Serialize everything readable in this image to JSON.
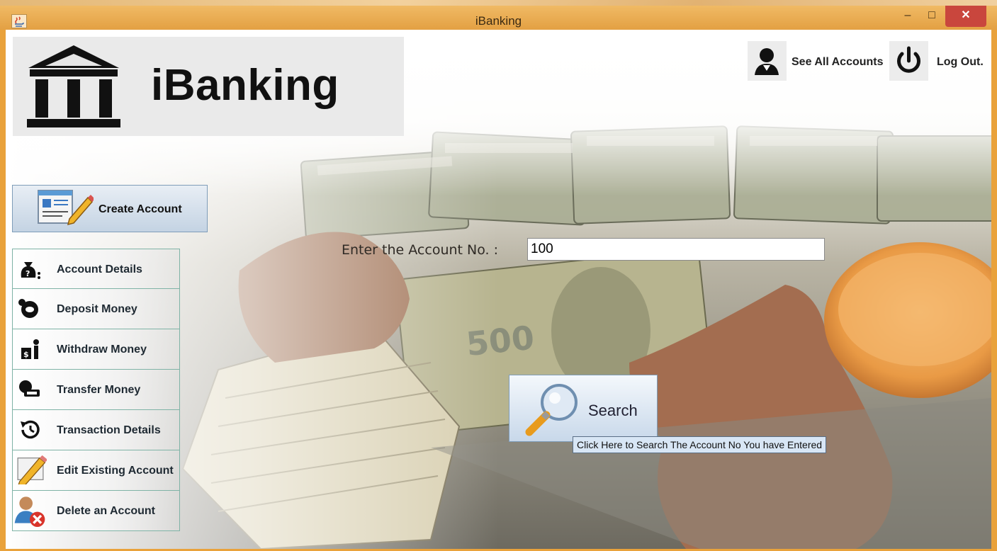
{
  "window": {
    "title": "iBanking",
    "minimize_glyph": "‒",
    "maximize_glyph": "□",
    "close_glyph": "✕"
  },
  "header": {
    "brand": "iBanking",
    "see_all_accounts": "See All Accounts",
    "log_out": "Log Out."
  },
  "create_account": {
    "label": "Create Account",
    "icon": "form-pencil-icon"
  },
  "sidebar": {
    "items": [
      {
        "label": "Account Details",
        "icon": "money-bag-question-icon"
      },
      {
        "label": "Deposit Money",
        "icon": "coin-deposit-icon"
      },
      {
        "label": "Withdraw Money",
        "icon": "withdraw-person-icon"
      },
      {
        "label": "Transfer Money",
        "icon": "money-transfer-icon"
      },
      {
        "label": "Transaction Details",
        "icon": "history-icon"
      },
      {
        "label": "Edit Existing Account",
        "icon": "edit-pencil-icon"
      },
      {
        "label": "Delete an Account",
        "icon": "delete-user-icon"
      }
    ]
  },
  "search_form": {
    "prompt": "Enter the Account No. :",
    "account_no": "100",
    "search_label": "Search",
    "tooltip": "Click Here to Search The Account No You have Entered"
  },
  "colors": {
    "titlebar": "#e9a23b",
    "close_button": "#c9463d",
    "button_border": "#7f9db9",
    "sidebar_border": "#7fb3a6"
  }
}
